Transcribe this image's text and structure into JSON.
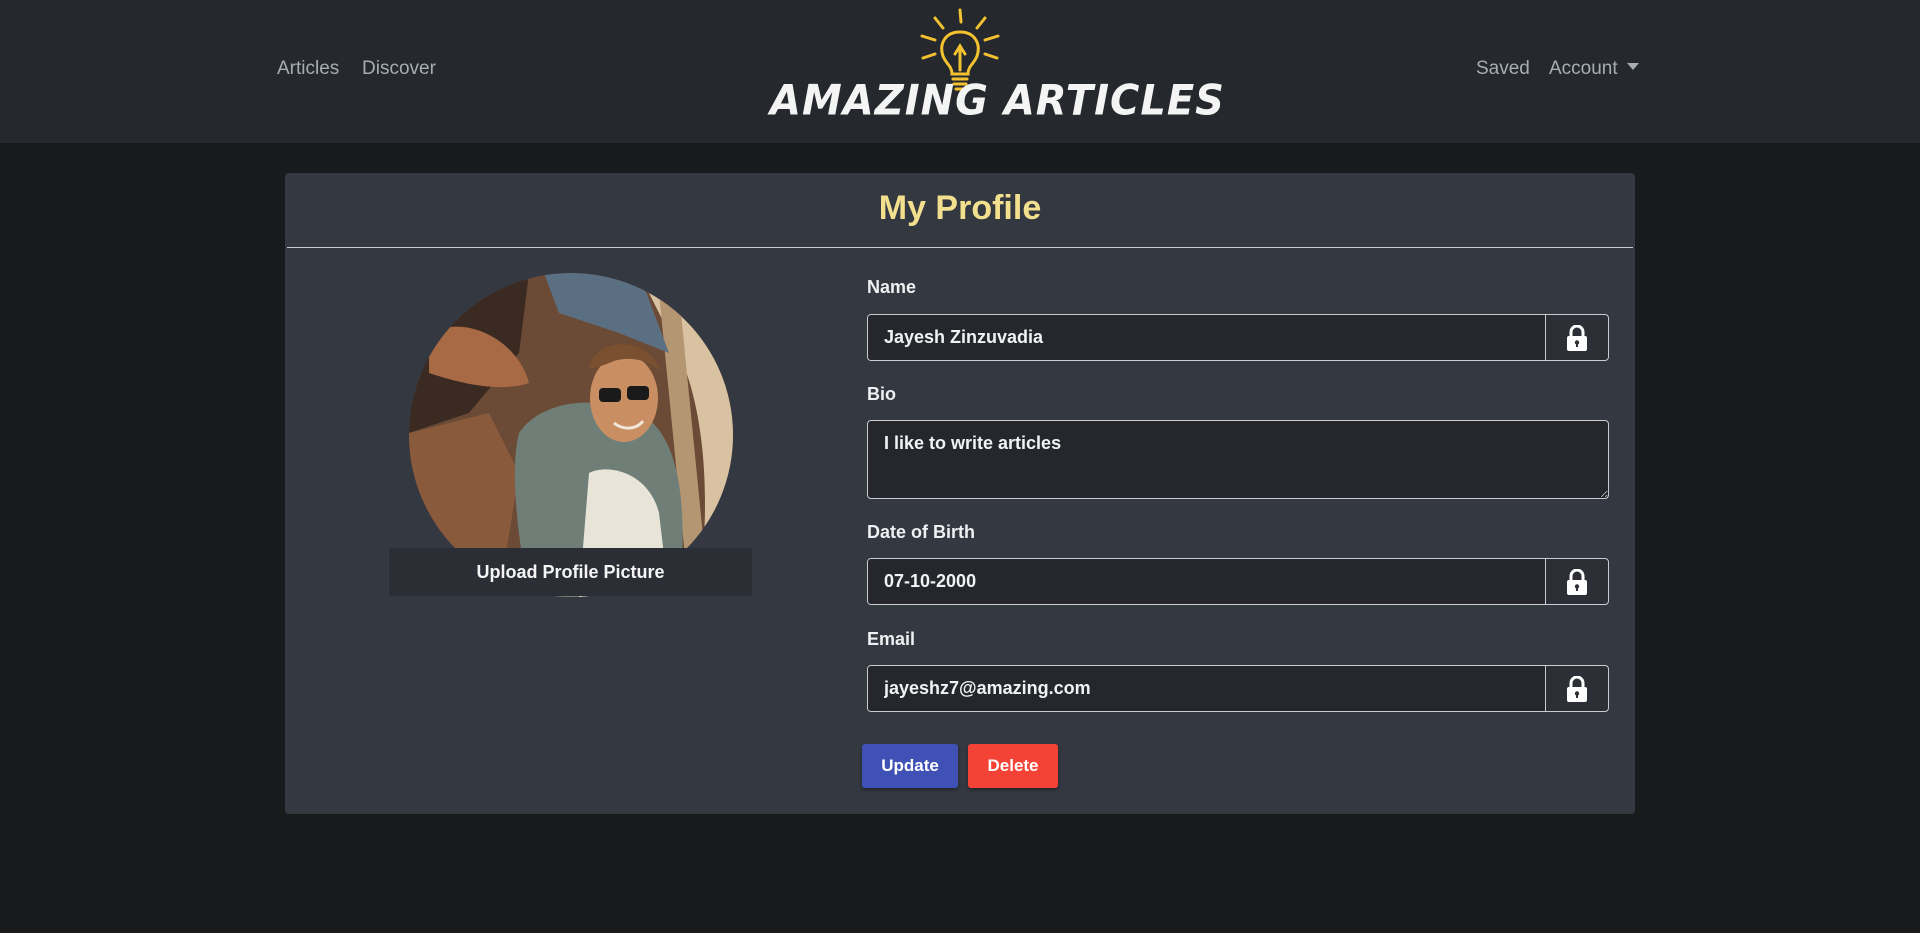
{
  "nav": {
    "left_links": [
      "Articles",
      "Discover"
    ],
    "saved": "Saved",
    "account": "Account"
  },
  "logo": {
    "text": "AMAZING ARTICLES",
    "bulb_color": "#f2c230"
  },
  "profile": {
    "title": "My Profile",
    "upload_label": "Upload Profile Picture",
    "fields": {
      "name_label": "Name",
      "name_value": "Jayesh Zinzuvadia",
      "bio_label": "Bio",
      "bio_value": "I like to write articles",
      "dob_label": "Date of Birth",
      "dob_value": "07-10-2000",
      "email_label": "Email",
      "email_value": "jayeshz7@amazing.com"
    },
    "lock_icon": "lock-icon",
    "buttons": {
      "update": "Update",
      "delete": "Delete"
    }
  },
  "colors": {
    "title": "#f3e08e",
    "update": "#3f51b5",
    "delete": "#f44336"
  }
}
